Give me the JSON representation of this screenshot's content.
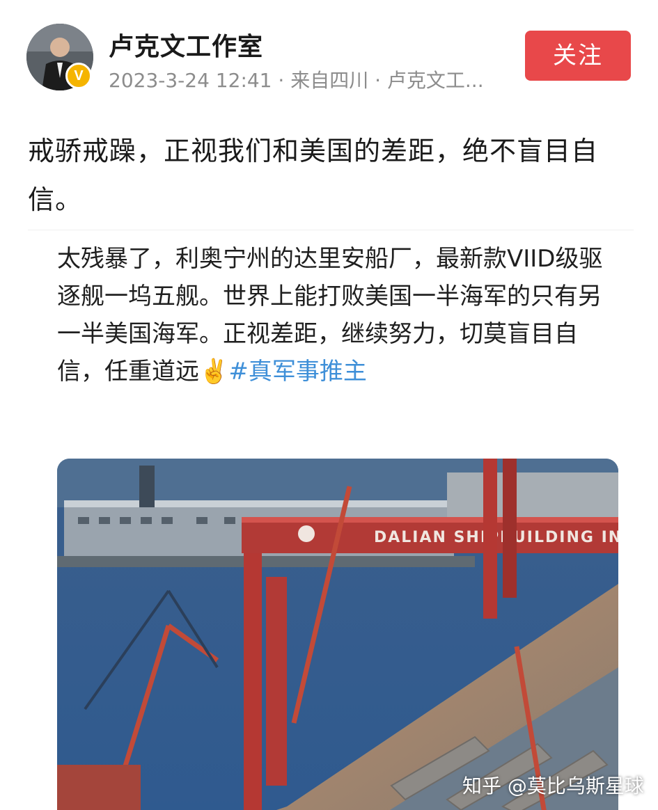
{
  "author": {
    "name": "卢克文工作室",
    "verified_badge": "V",
    "meta": "2023-3-24 12:41 · 来自四川 · 卢克文工..."
  },
  "actions": {
    "follow_label": "关注"
  },
  "post": {
    "text": "戒骄戒躁，正视我们和美国的差距，绝不盲目自信。"
  },
  "repost": {
    "text": "太残暴了，利奥宁州的达里安船厂，最新款VIID级驱逐舰一坞五舰。世界上能打败美国一半海军的只有另一半美国海军。正视差距，继续努力，切莫盲目自信，任重道远✌️",
    "hashtag": "#真军事推主",
    "image": {
      "banner_text": "DALIAN SHIPBUILDING INDUSTRY"
    }
  },
  "watermark": "知乎 @莫比乌斯星球",
  "colors": {
    "follow_button": "#e8484a",
    "hashtag": "#3e8fd8",
    "meta_text": "#8c8c8c",
    "badge": "#f5b400"
  }
}
